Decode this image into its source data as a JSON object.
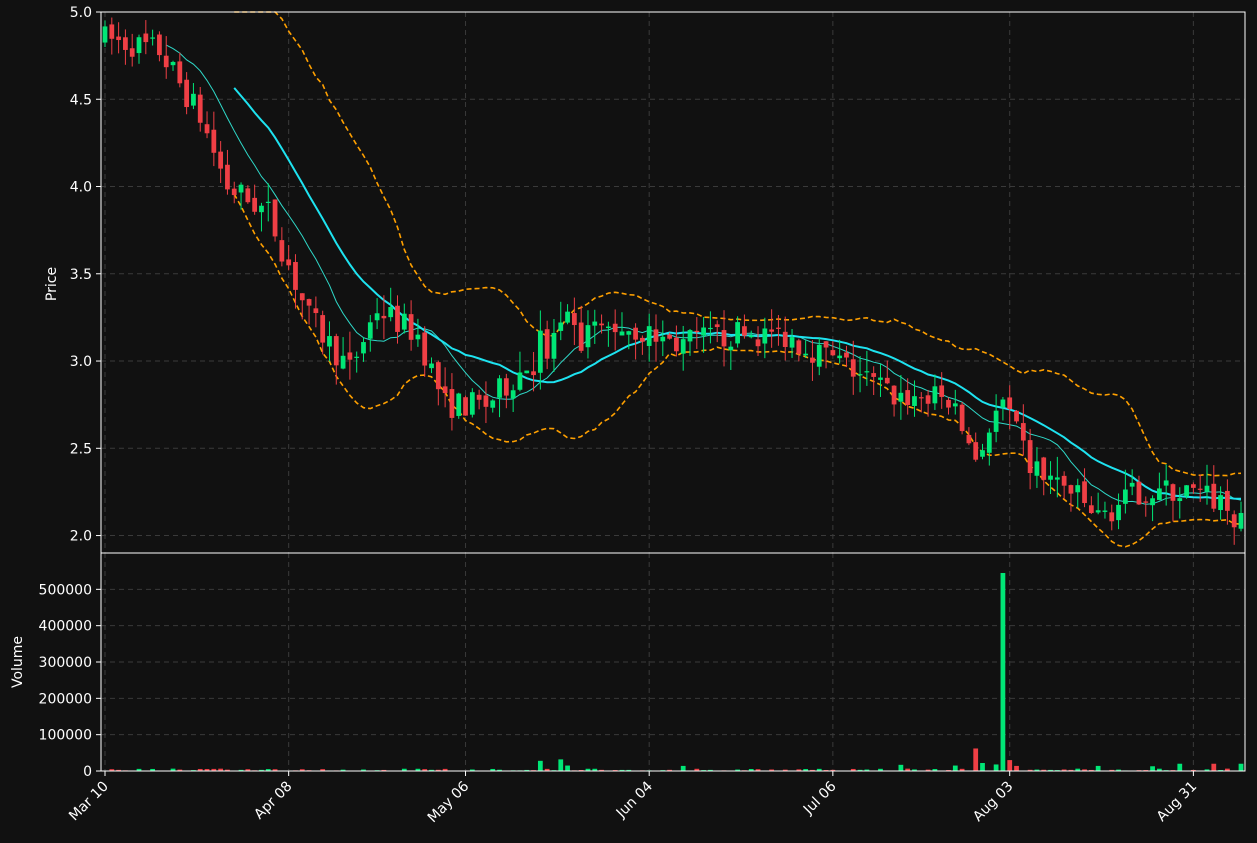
{
  "colors": {
    "background": "#111111",
    "grid": "#3a3a3a",
    "axis": "#ffffff",
    "text": "#ffffff",
    "up": "#00e676",
    "down": "#ef3f45",
    "ma_fast": "#2fd8c8",
    "ma_slow": "#1ee3f0",
    "band": "#ffa000"
  },
  "chart_data": [
    {
      "type": "candlestick",
      "ylabel": "Price",
      "ylim": [
        1.9,
        5.0
      ],
      "yticks": [
        2.0,
        2.5,
        3.0,
        3.5,
        4.0,
        4.5,
        5.0
      ],
      "xticks": [
        "Mar 10",
        "Apr 08",
        "May 06",
        "Jun 04",
        "Jul 06",
        "Aug 03",
        "Aug 31"
      ],
      "grid": true,
      "indicator_lines": [
        {
          "role": "moving-average-fast",
          "color": "#2fd8c8"
        },
        {
          "role": "moving-average-slow",
          "color": "#1ee3f0"
        },
        {
          "role": "upper-band",
          "color": "#ffa000",
          "style": "dashed"
        },
        {
          "role": "lower-band",
          "color": "#ffa000",
          "style": "dashed"
        }
      ]
    },
    {
      "type": "bar",
      "ylabel": "Volume",
      "ylim": [
        0,
        600000
      ],
      "yticks": [
        0,
        100000,
        200000,
        300000,
        400000,
        500000
      ],
      "grid": true,
      "peak_volume": 545000
    }
  ]
}
